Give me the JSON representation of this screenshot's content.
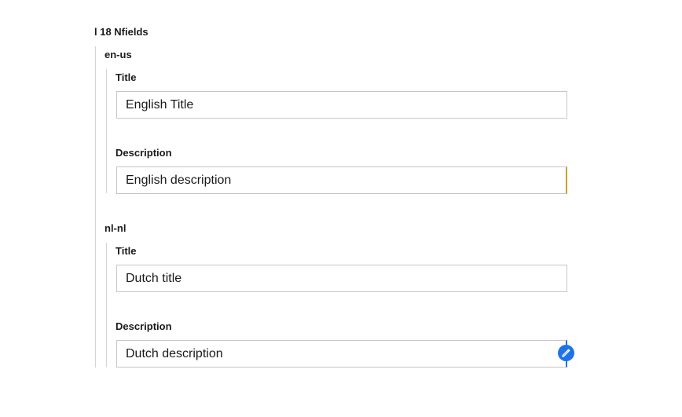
{
  "root": {
    "title": "l 18 Nfields"
  },
  "locales": [
    {
      "code": "en-us",
      "fields": [
        {
          "label": "Title",
          "value": "English Title"
        },
        {
          "label": "Description",
          "value": "English description"
        }
      ]
    },
    {
      "code": "nl-nl",
      "fields": [
        {
          "label": "Title",
          "value": "Dutch title"
        },
        {
          "label": "Description",
          "value": "Dutch description"
        }
      ]
    }
  ],
  "colors": {
    "modified_indicator": "#c9a227",
    "editing_indicator": "#1e73e8",
    "group_border": "#d4d4d4",
    "input_border": "#c7c7c7"
  },
  "icons": {
    "edit_badge": "pencil-icon"
  }
}
